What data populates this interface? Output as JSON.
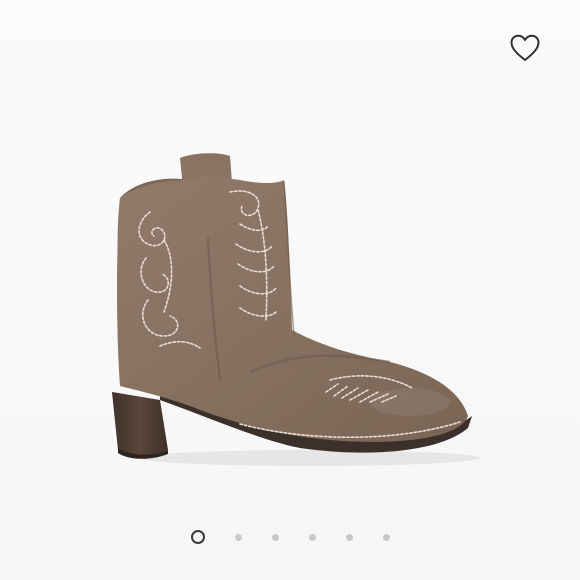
{
  "favorite": {
    "icon": "heart-outline-icon",
    "color": "#2f2f2f"
  },
  "product_image": {
    "subject": "boot-icon",
    "colors": {
      "suede": "#8a7262",
      "suede_shadow": "#6e5a4c",
      "heel": "#4a3a30",
      "sole": "#3b302a",
      "stitch": "#e9ddd0"
    }
  },
  "carousel": {
    "total": 6,
    "active_index": 0
  }
}
